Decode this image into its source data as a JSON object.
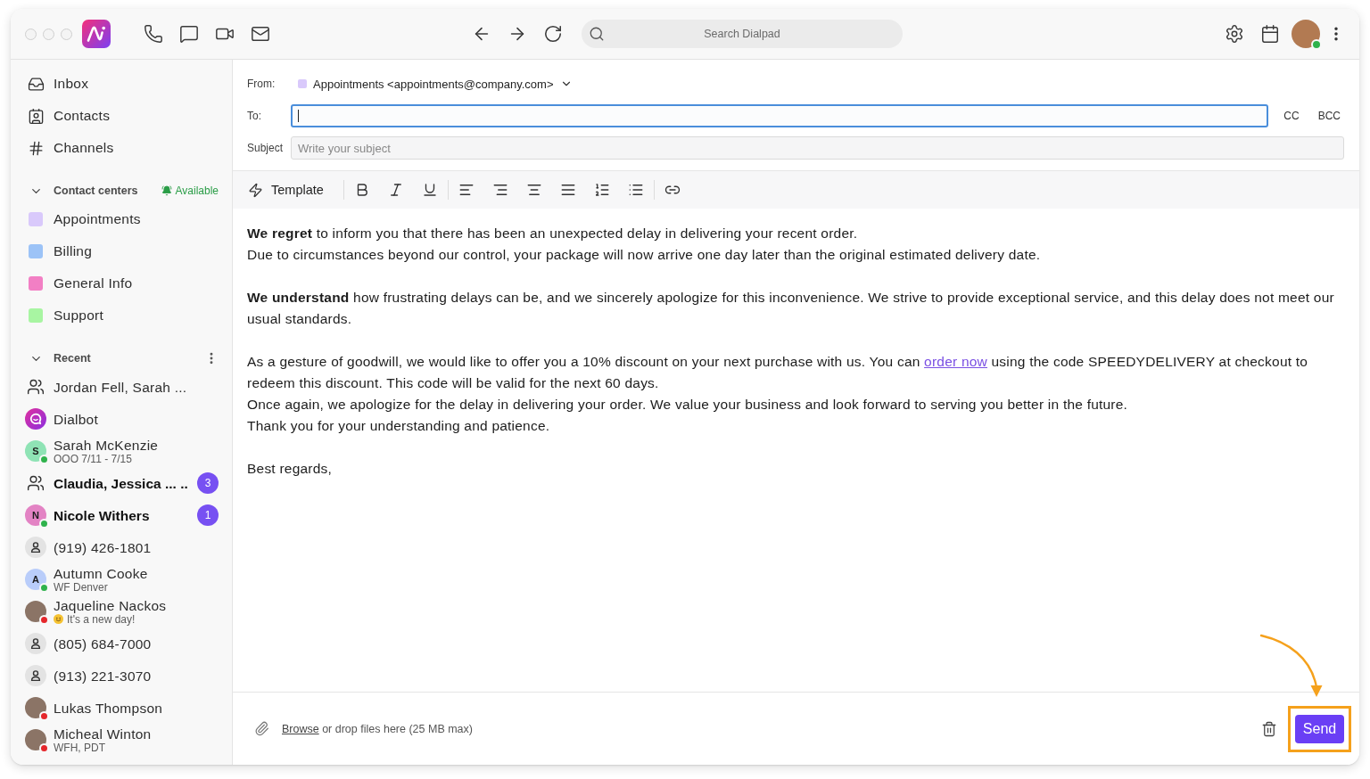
{
  "top_bar": {
    "search": {
      "placeholder": "Search Dialpad"
    },
    "user": {
      "available": true
    }
  },
  "sidebar": {
    "nav": [
      {
        "kind": "inbox",
        "label": "Inbox"
      },
      {
        "kind": "contacts",
        "label": "Contacts"
      },
      {
        "kind": "channels",
        "label": "Channels"
      }
    ],
    "contact_centers": {
      "title": "Contact centers",
      "expanded": true,
      "status": "Available",
      "items": [
        {
          "label": "Appointments",
          "color": "#d9c9fb"
        },
        {
          "label": "Billing",
          "color": "#9cc3f7"
        },
        {
          "label": "General Info",
          "color": "#f27fc4"
        },
        {
          "label": "Support",
          "color": "#a8f5a2"
        }
      ]
    },
    "recent": {
      "title": "Recent",
      "expanded": true,
      "items": [
        {
          "kind": "group",
          "name": "Jordan Fell, Sarah ...",
          "unread": false
        },
        {
          "kind": "bot",
          "name": "Dialbot",
          "unread": false
        },
        {
          "kind": "initial",
          "initial": "S",
          "color": "#8fe3b5",
          "available": true,
          "name": "Sarah McKenzie",
          "status": "OOO 7/11 - 7/15",
          "unread": false
        },
        {
          "kind": "group",
          "name": "Claudia, Jessica ... ..",
          "unread": true,
          "badge": "3"
        },
        {
          "kind": "initial",
          "initial": "N",
          "color": "#e383c4",
          "available": true,
          "name": "Nicole Withers",
          "unread": true,
          "badge": "1"
        },
        {
          "kind": "number",
          "name": "(919) 426-1801",
          "unread": false
        },
        {
          "kind": "initial",
          "initial": "A",
          "color": "#b9cdfa",
          "available": true,
          "name": "Autumn Cooke",
          "status": "WF Denver",
          "unread": false
        },
        {
          "kind": "photo",
          "available": false,
          "name": "Jaqueline Nackos",
          "status": "It's a new day!",
          "status_emoji": true,
          "unread": false
        },
        {
          "kind": "number",
          "name": "(805) 684-7000",
          "unread": false
        },
        {
          "kind": "number",
          "name": "(913) 221-3070",
          "unread": false
        },
        {
          "kind": "photo",
          "available": false,
          "name": "Lukas Thompson",
          "unread": false
        },
        {
          "kind": "photo",
          "available": false,
          "name": "Micheal Winton",
          "status": "WFH, PDT",
          "unread": false
        }
      ]
    }
  },
  "compose": {
    "from": {
      "label": "From:",
      "value": "Appointments <appointments@company.com>",
      "color": "#d9c9fb"
    },
    "to": {
      "label": "To:",
      "focused": true
    },
    "cc": "CC",
    "bcc": "BCC",
    "subject": {
      "label": "Subject",
      "placeholder": "Write your subject"
    },
    "toolbar": {
      "template": "Template",
      "tool_groups": [
        [
          {
            "kind": "bold"
          },
          {
            "kind": "italic"
          },
          {
            "kind": "underline"
          }
        ],
        [
          {
            "kind": "align-left"
          },
          {
            "kind": "align-right"
          },
          {
            "kind": "align-center"
          },
          {
            "kind": "justify"
          },
          {
            "kind": "numbered-list"
          },
          {
            "kind": "bullet-list"
          }
        ],
        [
          {
            "kind": "link"
          }
        ]
      ]
    },
    "body": [
      [
        {
          "text": "**We regret** to inform you that there has been an unexpected delay in delivering your recent order."
        },
        {
          "text": "Due to circumstances beyond our control, your package will now arrive one day later than the original estimated delivery date."
        }
      ],
      [
        {
          "text": "**We understand** how frustrating delays can be, and we sincerely apologize for this inconvenience. We strive to provide exceptional service, and this delay does not meet our usual standards."
        }
      ],
      [
        {
          "text": "As a gesture of goodwill, we would like to offer you a 10% discount on your next purchase with us. You can",
          "link": "order now",
          "text_after": "using the code SPEEDYDELIVERY at checkout to redeem this discount. This code will be valid for the next 60 days."
        },
        {
          "text": "Once again, we apologize for the delay in delivering your order. We value your business and look forward to serving you better in the future."
        },
        {
          "text": "Thank you for your understanding and patience."
        }
      ],
      [
        {
          "text": "Best regards,"
        }
      ]
    ],
    "footer": {
      "attach_link": "Browse",
      "attach_text": "or drop files here (25 MB max)",
      "send": {
        "label": "Send",
        "highlighted": true
      }
    }
  }
}
